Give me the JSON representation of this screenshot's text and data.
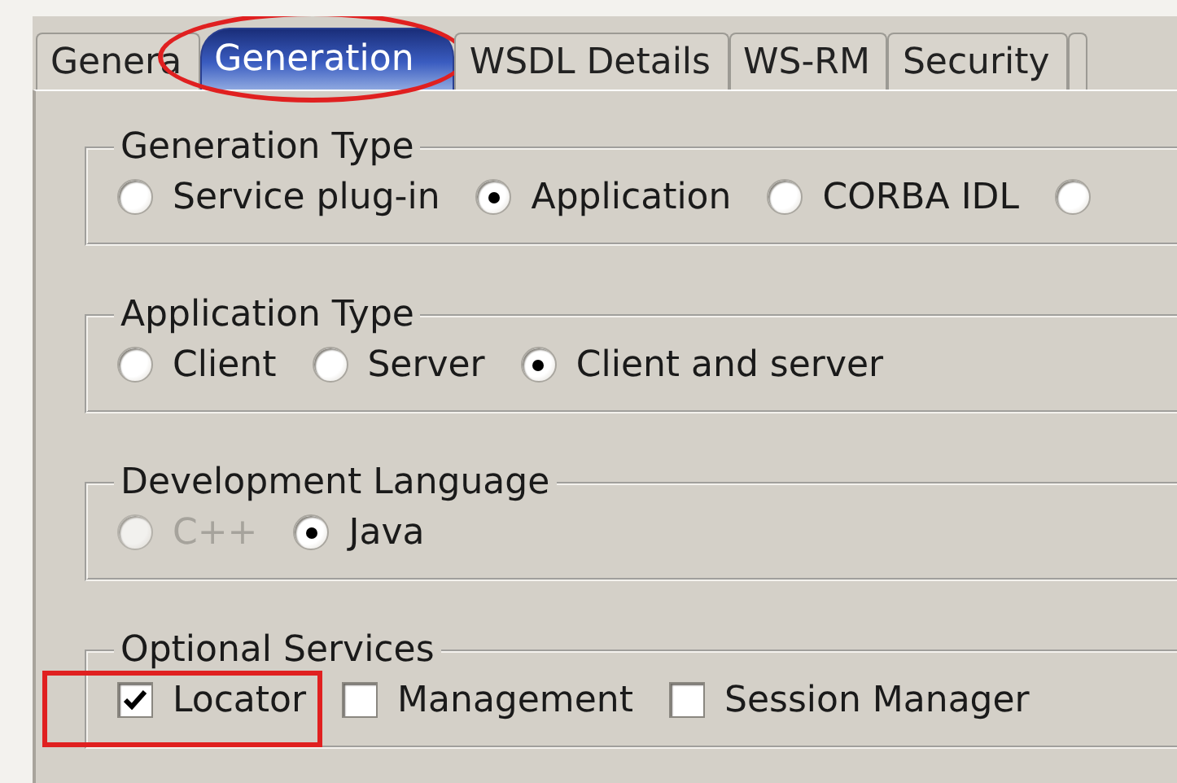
{
  "tabs": [
    {
      "label": "Genera",
      "selected": false,
      "highlighted": false
    },
    {
      "label": "Generation",
      "selected": true,
      "highlighted": true
    },
    {
      "label": "WSDL Details",
      "selected": false,
      "highlighted": false
    },
    {
      "label": "WS-RM",
      "selected": false,
      "highlighted": false
    },
    {
      "label": "Security",
      "selected": false,
      "highlighted": false
    },
    {
      "selected": false,
      "highlighted": false
    }
  ],
  "groups": [
    {
      "title": "Generation Type",
      "options": [
        {
          "kind": "radio",
          "label": "Service plug-in",
          "selected": false,
          "disabled": false,
          "highlighted": false
        },
        {
          "kind": "radio",
          "label": "Application",
          "selected": true,
          "disabled": false,
          "highlighted": false
        },
        {
          "kind": "radio",
          "label": "CORBA IDL",
          "selected": false,
          "disabled": false,
          "highlighted": false
        },
        {
          "kind": "radio",
          "selected": false,
          "disabled": false,
          "highlighted": false
        }
      ]
    },
    {
      "title": "Application Type",
      "options": [
        {
          "kind": "radio",
          "label": "Client",
          "selected": false,
          "disabled": false,
          "highlighted": false
        },
        {
          "kind": "radio",
          "label": "Server",
          "selected": false,
          "disabled": false,
          "highlighted": false
        },
        {
          "kind": "radio",
          "label": "Client and server",
          "selected": true,
          "disabled": false,
          "highlighted": false
        }
      ]
    },
    {
      "title": "Development Language",
      "options": [
        {
          "kind": "radio",
          "label": "C++",
          "selected": false,
          "disabled": true,
          "highlighted": false
        },
        {
          "kind": "radio",
          "label": "Java",
          "selected": true,
          "disabled": false,
          "highlighted": false
        }
      ]
    },
    {
      "title": "Optional Services",
      "options": [
        {
          "kind": "checkbox",
          "label": "Locator",
          "checked": true,
          "disabled": false,
          "highlighted": true
        },
        {
          "kind": "checkbox",
          "label": "Management",
          "checked": false,
          "disabled": false,
          "highlighted": false
        },
        {
          "kind": "checkbox",
          "label": "Session Manager",
          "checked": false,
          "disabled": false,
          "highlighted": false
        }
      ]
    }
  ]
}
